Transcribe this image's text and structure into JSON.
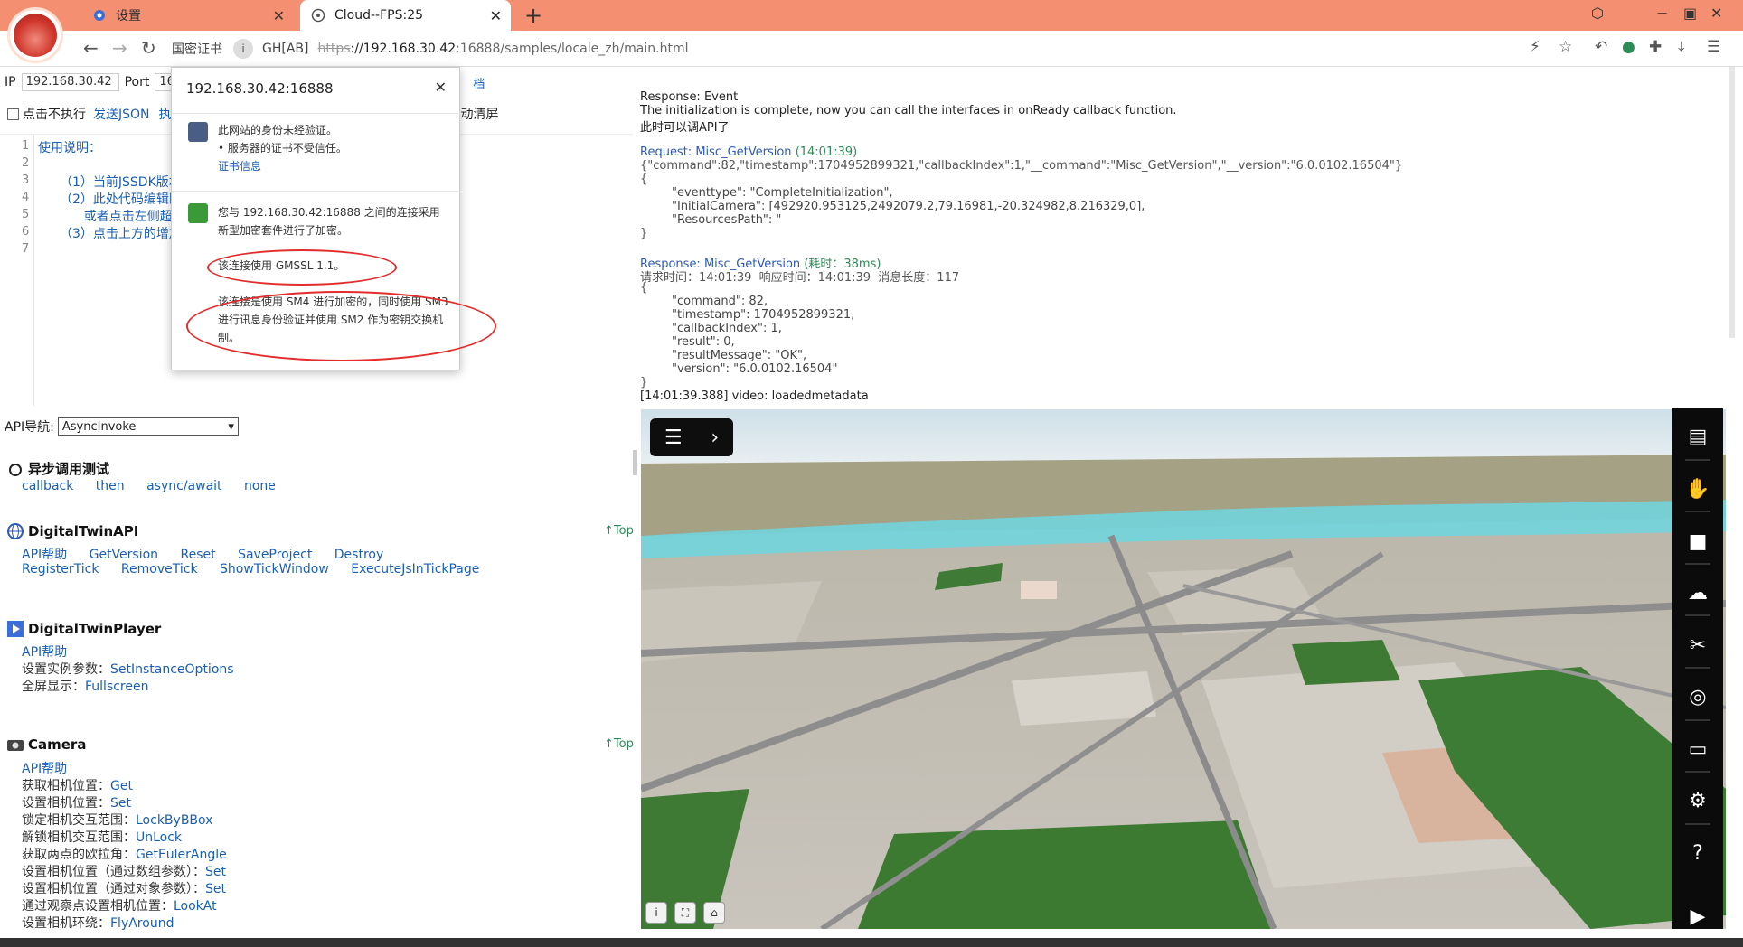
{
  "tabs": [
    {
      "label": "设置"
    },
    {
      "label": "Cloud--FPS:25"
    }
  ],
  "toolbar": {
    "cert_label": "国密证书",
    "gh_label": "GH[AB]",
    "url_scheme": "https",
    "url_host": "://192.168.30.42",
    "url_path": ":16888/samples/locale_zh/main.html"
  },
  "left": {
    "ip_label": "IP",
    "ip_value": "192.168.30.42",
    "port_label": "Port",
    "port_value": "16",
    "doc_tail": "档",
    "no_exec_label": "点击不执行",
    "send_json": "发送JSON",
    "exec_short": "执",
    "auto_clear_tail": "动清屏",
    "code_lines": [
      {
        "n": "1",
        "text": "使用说明："
      },
      {
        "n": "2",
        "text": ""
      },
      {
        "n": "3",
        "text": "（1）当前JSSDK版本"
      },
      {
        "n": "4",
        "text": "（2）此处代码编辑区"
      },
      {
        "n": "5",
        "text": "      或者点击左侧超"
      },
      {
        "n": "6",
        "text": "（3）点击上方的增加"
      },
      {
        "n": "7",
        "text": ""
      }
    ],
    "api_nav_label": "API导航:",
    "api_nav_value": "AsyncInvoke",
    "async_title": "异步调用测试",
    "async_links": [
      "callback",
      "then",
      "async/await",
      "none"
    ],
    "dt_api_title": "DigitalTwinAPI",
    "top_label": "↑Top",
    "dt_api_row1": [
      "API帮助",
      "GetVersion",
      "Reset",
      "SaveProject",
      "Destroy"
    ],
    "dt_api_row2": [
      "RegisterTick",
      "RemoveTick",
      "ShowTickWindow",
      "ExecuteJsInTickPage"
    ],
    "dt_player_title": "DigitalTwinPlayer",
    "dt_player_help": "API帮助",
    "dt_player_set_label": "设置实例参数：",
    "dt_player_set_link": "SetInstanceOptions",
    "dt_player_fs_label": "全屏显示：",
    "dt_player_fs_link": "Fullscreen",
    "camera_title": "Camera",
    "camera_help": "API帮助",
    "camera_lines": [
      {
        "label": "获取相机位置：",
        "link": "Get"
      },
      {
        "label": "设置相机位置：",
        "link": "Set"
      },
      {
        "label": "锁定相机交互范围：",
        "link": "LockByBBox"
      },
      {
        "label": "解锁相机交互范围：",
        "link": "UnLock"
      },
      {
        "label": "获取两点的欧拉角：",
        "link": "GetEulerAngle"
      },
      {
        "label": "设置相机位置（通过数组参数）：",
        "link": "Set"
      },
      {
        "label": "设置相机位置（通过对象参数）：",
        "link": "Set"
      },
      {
        "label": "通过观察点设置相机位置：",
        "link": "LookAt"
      },
      {
        "label": "设置相机环绕：",
        "link": "FlyAround"
      }
    ]
  },
  "popup": {
    "title": "192.168.30.42:16888",
    "identity_line1": "此网站的身份未经验证。",
    "identity_line2": "• 服务器的证书不受信任。",
    "cert_info_link": "证书信息",
    "conn_text": "您与 192.168.30.42:16888 之间的连接采用新型加密套件进行了加密。",
    "gmssl_text": "该连接使用 GMSSL 1.1。",
    "sm_text": "该连接是使用 SM4 进行加密的，同时使用 SM3 进行讯息身份验证并使用 SM2 作为密钥交换机制。"
  },
  "console": {
    "resp1_label": "Response: Event",
    "resp1_line2": "The initialization is complete, now you can call the interfaces in onReady callback function.",
    "resp1_line3": "此时可以调API了",
    "req_label": "Request: Misc_GetVersion",
    "req_time": "(14:01:39)",
    "req_json": "{\"command\":82,\"timestamp\":1704952899321,\"callbackIndex\":1,\"__command\":\"Misc_GetVersion\",\"__version\":\"6.0.0102.16504\"}",
    "brace_open": "{",
    "brace_close": "}",
    "ev_lines": [
      "\"eventtype\": \"CompleteInitialization\",",
      "\"InitialCamera\": [492920.953125,2492079.2,79.16981,-20.324982,8.216329,0],",
      "\"ResourcesPath\": \""
    ],
    "resp2_label": "Response: Misc_GetVersion",
    "resp2_time": "(耗时：38ms)",
    "resp2_meta": "请求时间：14:01:39  响应时间：14:01:39  消息长度：117",
    "resp2_lines": [
      "\"command\": 82,",
      "\"timestamp\": 1704952899321,",
      "\"callbackIndex\": 1,",
      "\"result\": 0,",
      "\"resultMessage\": \"OK\",",
      "\"version\": \"6.0.0102.16504\""
    ],
    "video_line": "[14:01:39.388] video: loadedmetadata"
  },
  "viewport": {
    "menu_icon": "menu-icon",
    "expand_icon": "chevron-right-icon",
    "sidebar_icons": [
      "layers-icon",
      "hand-icon",
      "camera-icon",
      "weather-icon",
      "tools-icon",
      "compass-icon",
      "print-icon",
      "settings-icon",
      "help-icon",
      "play-icon"
    ]
  }
}
